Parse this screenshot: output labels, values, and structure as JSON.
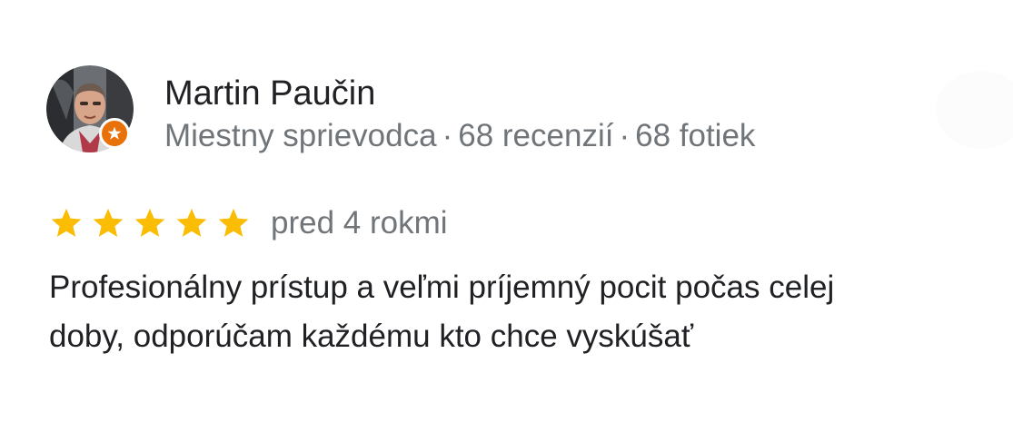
{
  "reviewer": {
    "name": "Martin Paučin",
    "badge": "Miestny sprievodca",
    "separator": "·",
    "reviews_count": "68 recenzií",
    "photos_count": "68 fotiek",
    "avatar_icon": "person-photo-icon",
    "badge_icon": "local-guide-star-icon"
  },
  "review": {
    "rating": 5,
    "rating_max": 5,
    "date": "pred 4 rokmi",
    "text": "Profesionálny prístup a veľmi príjemný pocit počas celej\ndoby, odporúčam každému kto chce vyskúšať"
  },
  "colors": {
    "star": "#fbbc04",
    "badge": "#e8710a",
    "secondary_text": "#70757a",
    "primary_text": "#202124"
  }
}
